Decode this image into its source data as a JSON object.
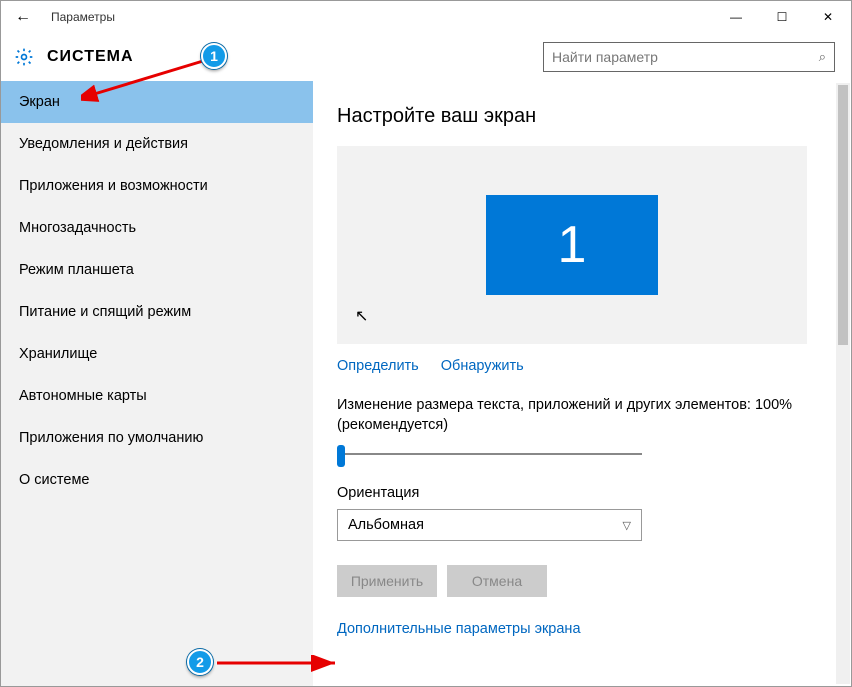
{
  "window": {
    "title": "Параметры",
    "back_icon": "←",
    "min_icon": "—",
    "max_icon": "☐",
    "close_icon": "✕"
  },
  "header": {
    "heading": "СИСТЕМА",
    "search_placeholder": "Найти параметр",
    "search_icon": "⌕"
  },
  "sidebar": {
    "items": [
      {
        "label": "Экран",
        "selected": true
      },
      {
        "label": "Уведомления и действия",
        "selected": false
      },
      {
        "label": "Приложения и возможности",
        "selected": false
      },
      {
        "label": "Многозадачность",
        "selected": false
      },
      {
        "label": "Режим планшета",
        "selected": false
      },
      {
        "label": "Питание и спящий режим",
        "selected": false
      },
      {
        "label": "Хранилище",
        "selected": false
      },
      {
        "label": "Автономные карты",
        "selected": false
      },
      {
        "label": "Приложения по умолчанию",
        "selected": false
      },
      {
        "label": "О системе",
        "selected": false
      }
    ]
  },
  "content": {
    "title": "Настройте ваш экран",
    "monitor_number": "1",
    "identify_label": "Определить",
    "detect_label": "Обнаружить",
    "scale_text": "Изменение размера текста, приложений и других элементов: 100% (рекомендуется)",
    "orientation_label": "Ориентация",
    "orientation_value": "Альбомная",
    "apply_label": "Применить",
    "cancel_label": "Отмена",
    "advanced_link": "Дополнительные параметры экрана"
  },
  "annotations": {
    "callout1": "1",
    "callout2": "2"
  }
}
